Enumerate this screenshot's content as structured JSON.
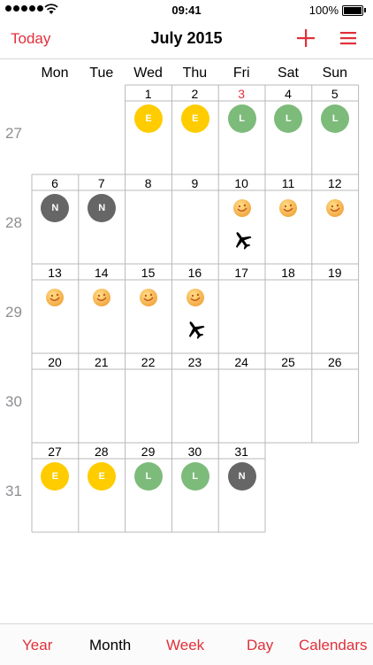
{
  "status": {
    "time": "09:41",
    "battery": "100%"
  },
  "nav": {
    "today_label": "Today",
    "title": "July 2015",
    "add_icon": "plus-icon",
    "menu_icon": "list-icon",
    "accent": "#e0303a"
  },
  "weekdays": [
    "Mon",
    "Tue",
    "Wed",
    "Thu",
    "Fri",
    "Sat",
    "Sun"
  ],
  "weeks": [
    {
      "number": "27",
      "days": [
        null,
        null,
        {
          "d": "1",
          "badge": "E"
        },
        {
          "d": "2",
          "badge": "E"
        },
        {
          "d": "3",
          "badge": "L",
          "today": true
        },
        {
          "d": "4",
          "badge": "L"
        },
        {
          "d": "5",
          "badge": "L"
        }
      ]
    },
    {
      "number": "28",
      "days": [
        {
          "d": "6",
          "badge": "N"
        },
        {
          "d": "7",
          "badge": "N"
        },
        {
          "d": "8"
        },
        {
          "d": "9"
        },
        {
          "d": "10",
          "emoji": true,
          "plane": true
        },
        {
          "d": "11",
          "emoji": true
        },
        {
          "d": "12",
          "emoji": true
        }
      ]
    },
    {
      "number": "29",
      "days": [
        {
          "d": "13",
          "emoji": true
        },
        {
          "d": "14",
          "emoji": true
        },
        {
          "d": "15",
          "emoji": true
        },
        {
          "d": "16",
          "emoji": true,
          "plane": true
        },
        {
          "d": "17"
        },
        {
          "d": "18"
        },
        {
          "d": "19"
        }
      ]
    },
    {
      "number": "30",
      "days": [
        {
          "d": "20"
        },
        {
          "d": "21"
        },
        {
          "d": "22"
        },
        {
          "d": "23"
        },
        {
          "d": "24"
        },
        {
          "d": "25"
        },
        {
          "d": "26"
        }
      ]
    },
    {
      "number": "31",
      "days": [
        {
          "d": "27",
          "badge": "E"
        },
        {
          "d": "28",
          "badge": "E"
        },
        {
          "d": "29",
          "badge": "L"
        },
        {
          "d": "30",
          "badge": "L"
        },
        {
          "d": "31",
          "badge": "N"
        },
        null,
        null
      ]
    }
  ],
  "badge_colors": {
    "E": "#ffcc00",
    "L": "#7dbb7a",
    "N": "#666666"
  },
  "tabs": [
    {
      "label": "Year",
      "active": false
    },
    {
      "label": "Month",
      "active": true
    },
    {
      "label": "Week",
      "active": false
    },
    {
      "label": "Day",
      "active": false
    },
    {
      "label": "Calendars",
      "active": false
    }
  ]
}
